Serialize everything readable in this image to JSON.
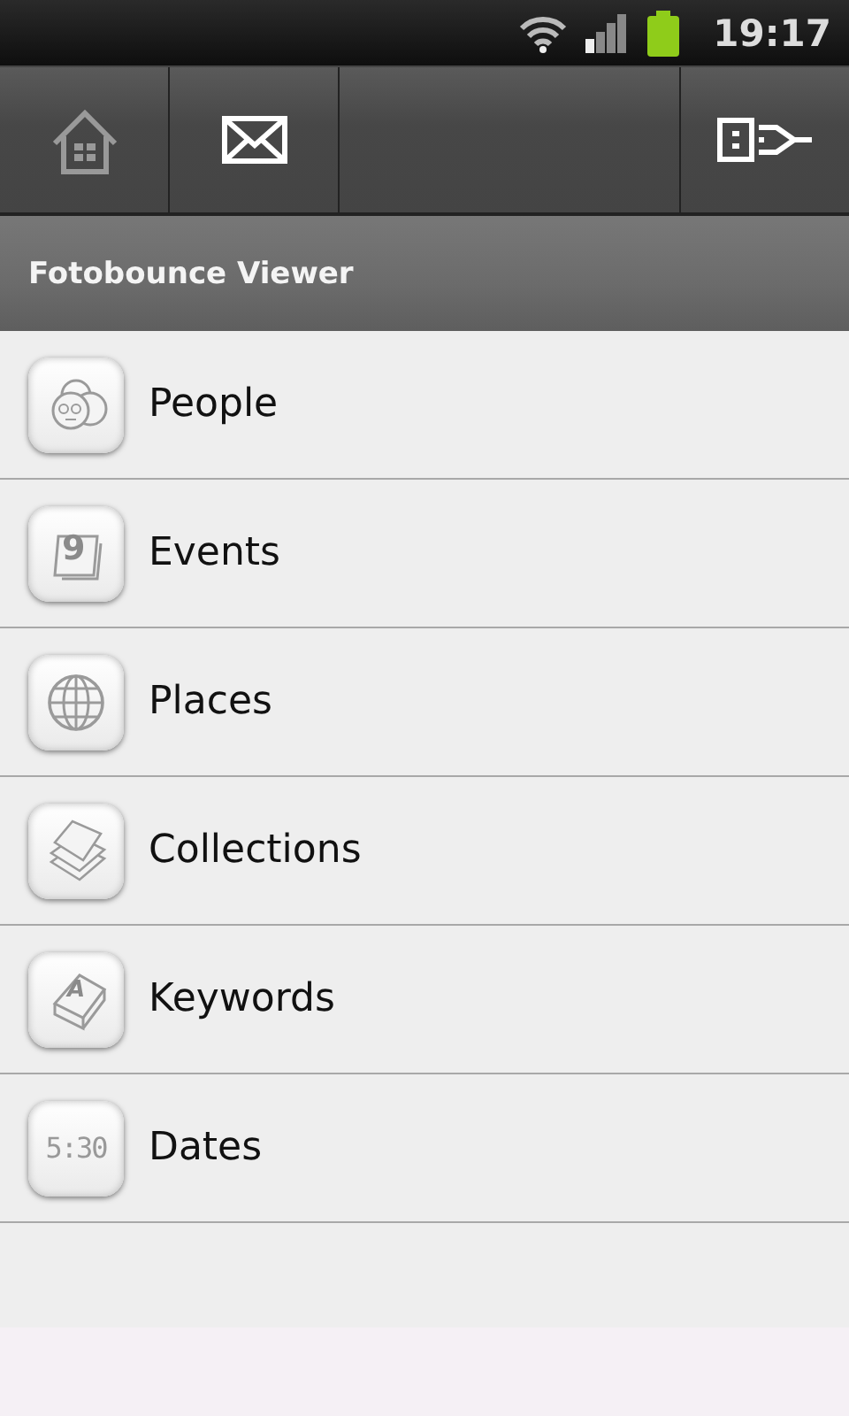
{
  "status_bar": {
    "time": "19:17"
  },
  "toolbar": [
    {
      "kind": "home"
    },
    {
      "kind": "mail"
    },
    {
      "kind": "empty"
    },
    {
      "kind": "logout"
    }
  ],
  "title_bar": {
    "title": "Fotobounce Viewer"
  },
  "menu": [
    {
      "label": "People",
      "kind": "people"
    },
    {
      "label": "Events",
      "kind": "calendar",
      "icon_text": "9"
    },
    {
      "label": "Places",
      "kind": "globe"
    },
    {
      "label": "Collections",
      "kind": "stack"
    },
    {
      "label": "Keywords",
      "kind": "key",
      "icon_text": "A"
    },
    {
      "label": "Dates",
      "kind": "clock",
      "icon_text": "5:30"
    }
  ]
}
